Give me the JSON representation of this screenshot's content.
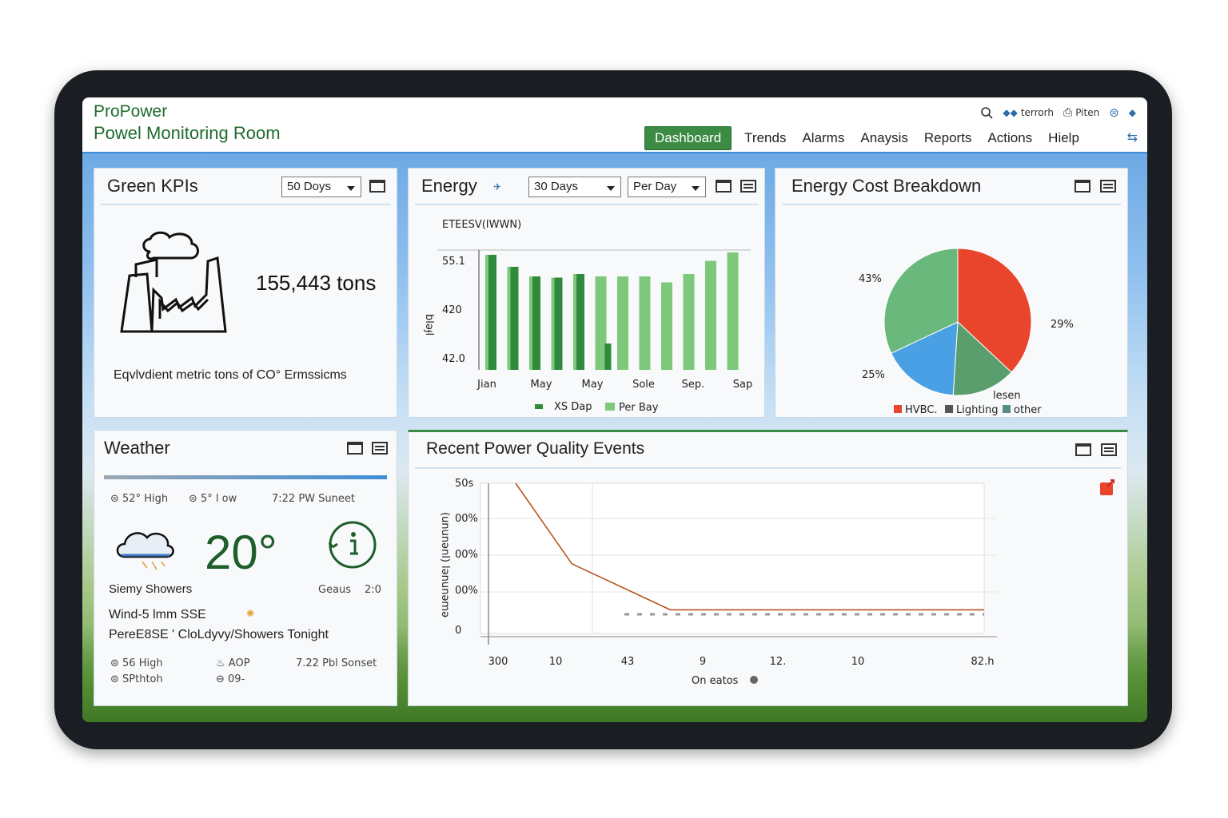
{
  "app": {
    "brand_line1": "ProPower",
    "brand_line2": "Powel Monitoring Room"
  },
  "top_tools": {
    "search_icon": "search-icon",
    "user_label": "terrorh",
    "print_label": "Piten"
  },
  "nav": {
    "tabs": [
      "Dashboard",
      "Trends",
      "Alarms",
      "Anaysis",
      "Reports",
      "Actions",
      "Hielp"
    ],
    "active": "Dashboard"
  },
  "kpi": {
    "title": "Green KPIs",
    "range": "50 Doys",
    "value": "155,443 tons",
    "caption": "Eqvlvdient metric tons of  CO° Ermssicms"
  },
  "energy": {
    "title": "Energy",
    "range": "30 Days",
    "interval": "Per Day",
    "legend_a": "XS Dap",
    "legend_b": "Per Bay",
    "chart_data": {
      "type": "bar",
      "title": "ETEESV(IWWN)",
      "ylabel": "bləɟl",
      "y_ticks": [
        "55.1",
        "420",
        "42.0"
      ],
      "x_ticks": [
        "Jian",
        "May",
        "May",
        "Sole",
        "Sep.",
        "Sap"
      ],
      "series": [
        {
          "name": "XS Dap",
          "color": "#2f8a3c",
          "values": [
            0.96,
            0.86,
            0.78,
            0.77,
            0.8,
            0.22,
            0.0,
            0.0,
            0.0,
            0.0,
            0.0,
            0.0
          ]
        },
        {
          "name": "Per Bay",
          "color": "#7ec87c",
          "values": [
            0.96,
            0.86,
            0.78,
            0.77,
            0.8,
            0.78,
            0.78,
            0.78,
            0.73,
            0.8,
            0.91,
            0.98
          ]
        }
      ]
    }
  },
  "cost": {
    "title": "Energy Cost Breakdown",
    "chart_data": {
      "type": "pie",
      "labels": [
        "43%",
        "29%",
        "25%"
      ],
      "legend": [
        "HVBC.",
        "Lighting",
        "other"
      ],
      "slices": [
        {
          "name": "HVBC.",
          "value": 37,
          "color": "#e8452c"
        },
        {
          "name": "other",
          "value": 14,
          "color": "#5a9e6e"
        },
        {
          "name": "Lighting",
          "value": 17,
          "color": "#4aa0e4"
        },
        {
          "name": "",
          "value": 32,
          "color": "#6ab87c"
        }
      ],
      "small_note": "lesen"
    }
  },
  "weather": {
    "title": "Weather",
    "top_row": [
      "52° High",
      "5° l ow",
      "7:22 PW Suneet"
    ],
    "temperature": "20°",
    "condition": "Siemy Showers",
    "gauge_label": "Geaus",
    "gauge_value": "2:0",
    "wind": "Wind-5 lmm SSE",
    "forecast": "PereE8SE   ' CloLdyvy/Showers Tonight",
    "bottom_left_1": "56 High",
    "bottom_left_2": "SPthtoh",
    "bottom_mid_1": "AOP",
    "bottom_mid_2": "09-",
    "bottom_right": "7.22 Pbl Sonset"
  },
  "events": {
    "title": "Recent Power Quality Events",
    "chart_data": {
      "type": "line",
      "ylabel": "(ununənl) lənunəmə",
      "xlabel": "On eatos",
      "y_ticks": [
        "50s",
        "00%",
        "00%",
        "00%",
        "0"
      ],
      "x_ticks": [
        "300",
        "10",
        "43",
        "9",
        "12.",
        "10",
        "82.h"
      ],
      "points": [
        [
          0.0,
          1.0
        ],
        [
          0.12,
          0.44
        ],
        [
          0.33,
          0.12
        ],
        [
          1.0,
          0.12
        ]
      ]
    }
  }
}
